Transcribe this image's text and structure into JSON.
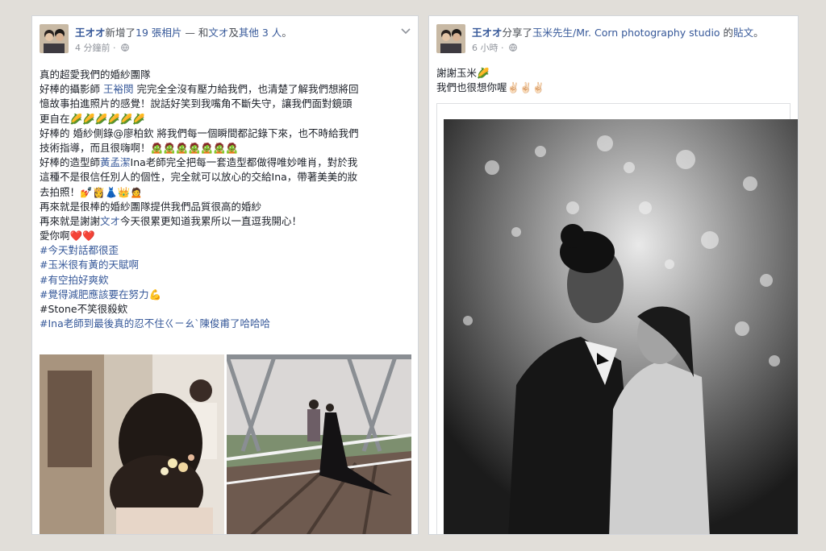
{
  "left_post": {
    "author": "王オオ",
    "action": "新增了",
    "photo_link": "19 張相片",
    "with_text": " — 和",
    "with_name": "文オ",
    "and_text": "及",
    "others": "其他 3 人",
    "period": "。",
    "time": "4 分鐘前",
    "sep": "·",
    "lines": [
      [
        {
          "t": "真的超愛我們的婚紗團隊"
        }
      ],
      [
        {
          "t": "好棒的攝影師 "
        },
        {
          "t": "王裕閔",
          "c": "tag"
        },
        {
          "t": " 完完全全沒有壓力給我們，也清楚了解我們想將回"
        }
      ],
      [
        {
          "t": "憶故事拍進照片的感覺！說話好笑到我嘴角不斷失守，讓我們面對鏡頭"
        }
      ],
      [
        {
          "t": "更自在"
        },
        {
          "t": "🌽🌽🌽🌽🌽🌽",
          "c": "emo"
        }
      ],
      [
        {
          "t": "好棒的 婚紗側錄@廖柏欽 將我們每一個瞬間都記錄下來，也不時給我們"
        }
      ],
      [
        {
          "t": "技術指導，而且很嗨啊！"
        },
        {
          "t": "🧟🧟🧟🧟🧟🧟🧟",
          "c": "emo"
        }
      ],
      [
        {
          "t": "好棒的造型師"
        },
        {
          "t": "黃孟潔",
          "c": "tag"
        },
        {
          "t": "Ina老師完全把每一套造型都做得唯妙唯肖，對於我"
        }
      ],
      [
        {
          "t": "這種不是很信任別人的個性，完全就可以放心的交給Ina，帶著美美的妝"
        }
      ],
      [
        {
          "t": "去拍照！"
        },
        {
          "t": "💅👸👗👑🙍",
          "c": "emo"
        }
      ],
      [
        {
          "t": "再來就是很棒的婚紗團隊提供我們品質很高的婚紗"
        }
      ],
      [
        {
          "t": "再來就是謝謝"
        },
        {
          "t": "文オ",
          "c": "tag"
        },
        {
          "t": "今天很累更知道我累所以一直逗我開心！"
        }
      ],
      [
        {
          "t": "愛你啊"
        },
        {
          "t": "❤️❤️",
          "c": "emo"
        }
      ],
      [
        {
          "t": "#今天對話都很歪",
          "c": "tag"
        }
      ],
      [
        {
          "t": "#玉米很有黃的天賦啊",
          "c": "tag"
        }
      ],
      [
        {
          "t": "#有空拍好爽欸",
          "c": "tag"
        }
      ],
      [
        {
          "t": "#覺得減肥應該要在努力",
          "c": "tag"
        },
        {
          "t": "💪",
          "c": "emo"
        }
      ],
      [
        {
          "t": "#Stone不笑很殺欸"
        }
      ],
      [
        {
          "t": "#Ina老師到最後真的忍不住ㄍㄧㄠˋ陳俊甫了哈哈哈",
          "c": "tag"
        }
      ]
    ]
  },
  "right_post": {
    "author": "王オオ",
    "action": "分享了",
    "page_name": "玉米先生/Mr. Corn photography studio",
    "of_text": " 的",
    "post_word": "貼文",
    "period": "。",
    "time": "6 小時",
    "sep": "·",
    "line1_text": "謝謝玉米",
    "line1_emoji": "🌽",
    "line2_text": "我們也很想你喔",
    "line2_emoji": "✌🏻✌🏻✌🏻"
  },
  "icons": {
    "globe": "globe-icon",
    "options": "chevron-down-icon"
  },
  "colors": {
    "link": "#365899",
    "meta": "#90949c",
    "background": "#e1ded9"
  }
}
